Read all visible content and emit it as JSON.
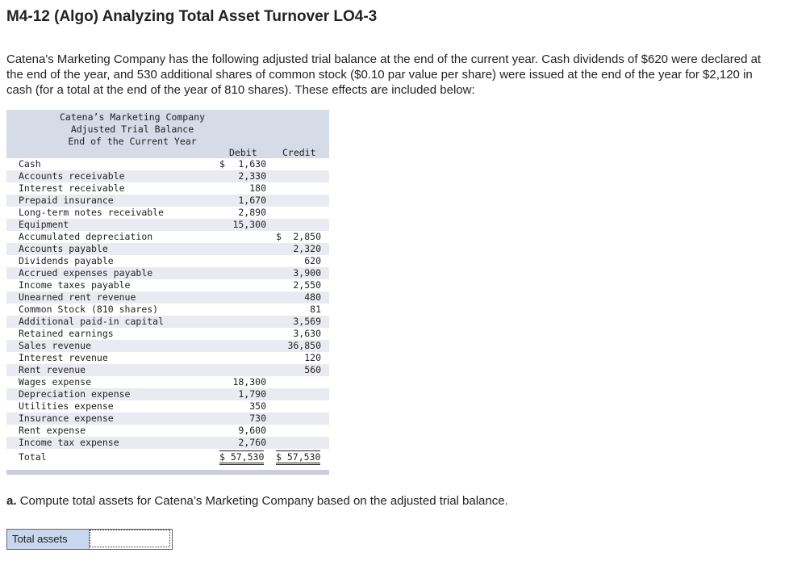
{
  "title": "M4-12 (Algo) Analyzing Total Asset Turnover LO4-3",
  "intro": "Catena's Marketing Company has the following adjusted trial balance at the end of the current year. Cash dividends of $620 were declared at the end of the year, and 530 additional shares of common stock ($0.10 par value per share) were issued at the end of the year for $2,120 in cash (for a total at the end of the year of 810 shares). These effects are included below:",
  "trial_balance": {
    "company": "Catena’s Marketing Company",
    "heading": "Adjusted Trial Balance",
    "period": "End of the Current Year",
    "debit_label": "Debit",
    "credit_label": "Credit",
    "rows": [
      {
        "account": "Cash",
        "debit_sign": "$",
        "debit": "1,630",
        "credit_sign": "",
        "credit": ""
      },
      {
        "account": "Accounts receivable",
        "debit_sign": "",
        "debit": "2,330",
        "credit_sign": "",
        "credit": ""
      },
      {
        "account": "Interest receivable",
        "debit_sign": "",
        "debit": "180",
        "credit_sign": "",
        "credit": ""
      },
      {
        "account": "Prepaid insurance",
        "debit_sign": "",
        "debit": "1,670",
        "credit_sign": "",
        "credit": ""
      },
      {
        "account": "Long-term notes receivable",
        "debit_sign": "",
        "debit": "2,890",
        "credit_sign": "",
        "credit": ""
      },
      {
        "account": "Equipment",
        "debit_sign": "",
        "debit": "15,300",
        "credit_sign": "",
        "credit": ""
      },
      {
        "account": "Accumulated depreciation",
        "debit_sign": "",
        "debit": "",
        "credit_sign": "$",
        "credit": "2,850"
      },
      {
        "account": "Accounts payable",
        "debit_sign": "",
        "debit": "",
        "credit_sign": "",
        "credit": "2,320"
      },
      {
        "account": "Dividends payable",
        "debit_sign": "",
        "debit": "",
        "credit_sign": "",
        "credit": "620"
      },
      {
        "account": "Accrued expenses payable",
        "debit_sign": "",
        "debit": "",
        "credit_sign": "",
        "credit": "3,900"
      },
      {
        "account": "Income taxes payable",
        "debit_sign": "",
        "debit": "",
        "credit_sign": "",
        "credit": "2,550"
      },
      {
        "account": "Unearned rent revenue",
        "debit_sign": "",
        "debit": "",
        "credit_sign": "",
        "credit": "480"
      },
      {
        "account": "Common Stock (810 shares)",
        "debit_sign": "",
        "debit": "",
        "credit_sign": "",
        "credit": "81"
      },
      {
        "account": "Additional paid-in capital",
        "debit_sign": "",
        "debit": "",
        "credit_sign": "",
        "credit": "3,569"
      },
      {
        "account": "Retained earnings",
        "debit_sign": "",
        "debit": "",
        "credit_sign": "",
        "credit": "3,630"
      },
      {
        "account": "Sales revenue",
        "debit_sign": "",
        "debit": "",
        "credit_sign": "",
        "credit": "36,850"
      },
      {
        "account": "Interest revenue",
        "debit_sign": "",
        "debit": "",
        "credit_sign": "",
        "credit": "120"
      },
      {
        "account": "Rent revenue",
        "debit_sign": "",
        "debit": "",
        "credit_sign": "",
        "credit": "560"
      },
      {
        "account": "Wages expense",
        "debit_sign": "",
        "debit": "18,300",
        "credit_sign": "",
        "credit": ""
      },
      {
        "account": "Depreciation expense",
        "debit_sign": "",
        "debit": "1,790",
        "credit_sign": "",
        "credit": ""
      },
      {
        "account": "Utilities expense",
        "debit_sign": "",
        "debit": "350",
        "credit_sign": "",
        "credit": ""
      },
      {
        "account": "Insurance expense",
        "debit_sign": "",
        "debit": "730",
        "credit_sign": "",
        "credit": ""
      },
      {
        "account": "Rent expense",
        "debit_sign": "",
        "debit": "9,600",
        "credit_sign": "",
        "credit": ""
      },
      {
        "account": "Income tax expense",
        "debit_sign": "",
        "debit": "2,760",
        "credit_sign": "",
        "credit": ""
      }
    ],
    "total_label": "Total",
    "total_debit": "$ 57,530",
    "total_credit": "$ 57,530"
  },
  "question": {
    "prefix": "a.",
    "text": " Compute total assets for Catena’s Marketing Company based on the adjusted trial balance."
  },
  "answer": {
    "label": "Total assets",
    "value": ""
  }
}
